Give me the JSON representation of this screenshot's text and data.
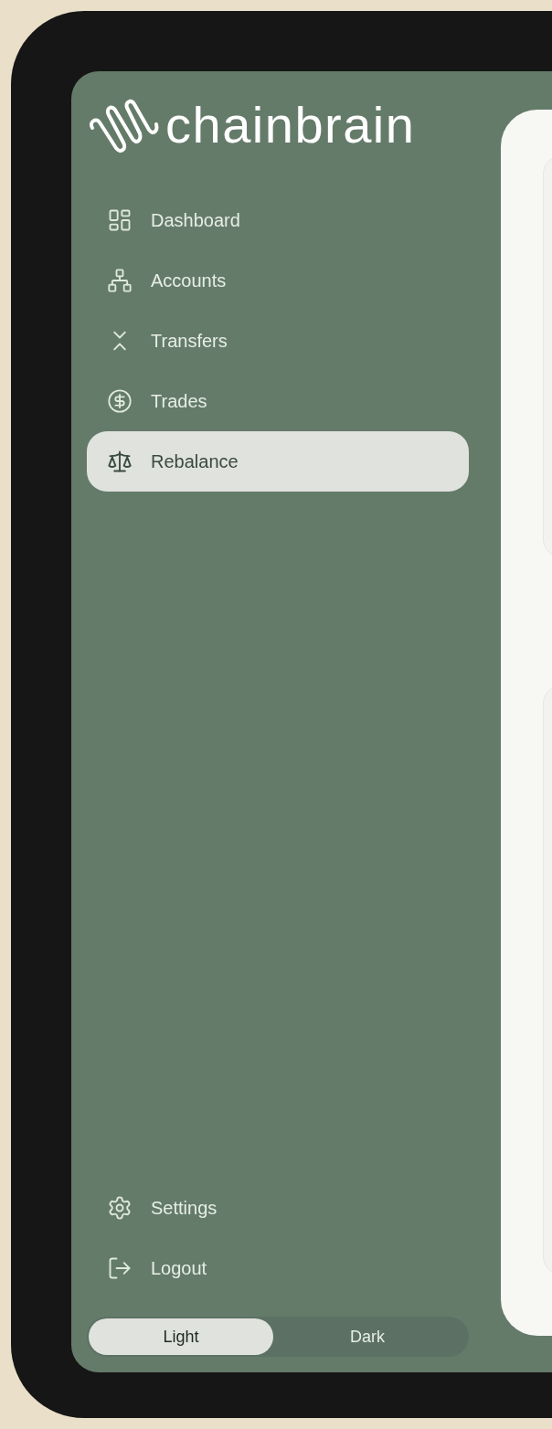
{
  "logo": {
    "text": "chainbrain"
  },
  "sidebar": {
    "items": [
      {
        "label": "Dashboard",
        "selected": false
      },
      {
        "label": "Accounts",
        "selected": false
      },
      {
        "label": "Transfers",
        "selected": false
      },
      {
        "label": "Trades",
        "selected": false
      },
      {
        "label": "Rebalance",
        "selected": true
      }
    ],
    "footer_items": [
      {
        "label": "Settings"
      },
      {
        "label": "Logout"
      }
    ]
  },
  "theme_toggle": [
    {
      "label": "Light",
      "selected": true
    },
    {
      "label": "Dark",
      "selected": false
    }
  ]
}
